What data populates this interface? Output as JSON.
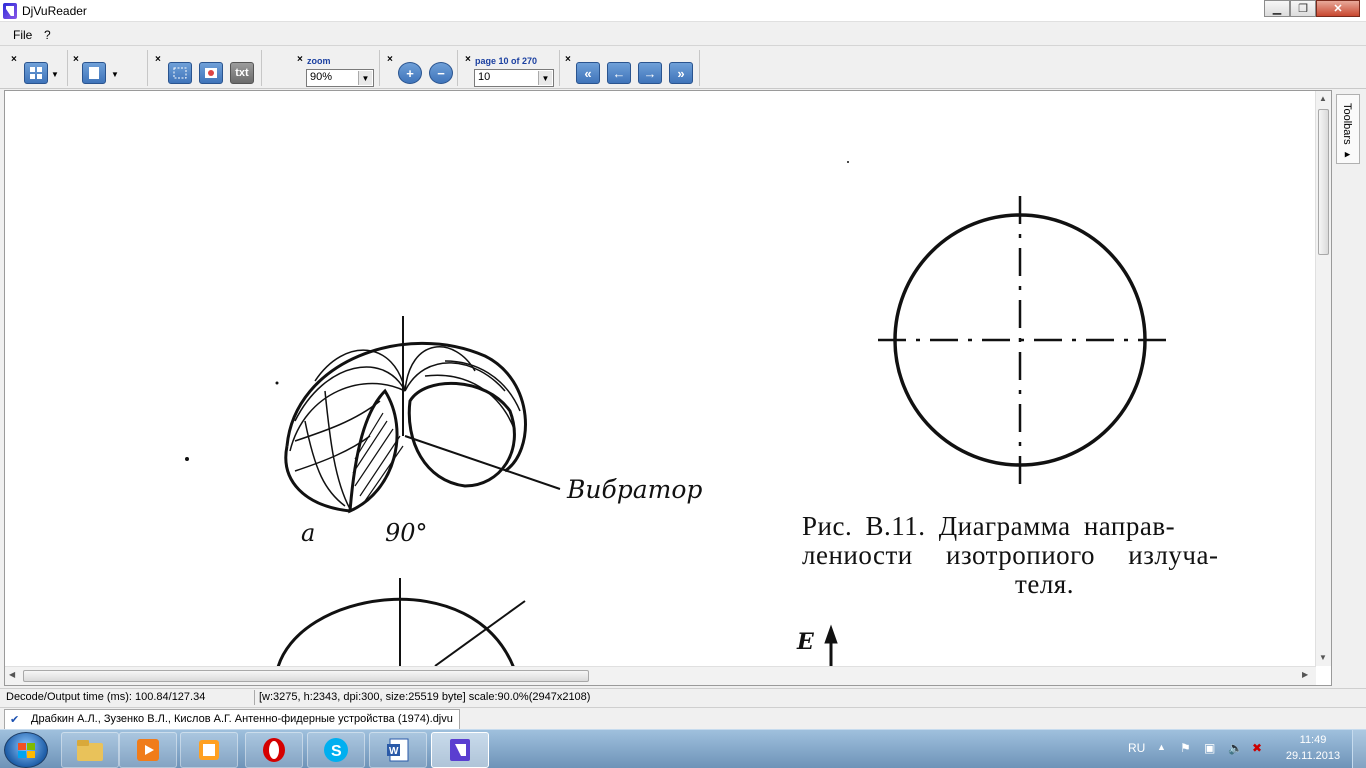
{
  "window": {
    "title": "DjVuReader",
    "minimize": "▁",
    "maximize": "❐",
    "close": "✕"
  },
  "menu": {
    "file": "File",
    "help": "?"
  },
  "toolbar": {
    "close_glyph": "×",
    "text_button": "txt",
    "zoom_label": "zoom",
    "zoom_value": "90%",
    "zoom_in": "+",
    "zoom_out": "−",
    "page_label": "page 10 of 270",
    "page_value": "10",
    "first_page": "«",
    "prev_page": "←",
    "next_page": "→",
    "last_page": "»"
  },
  "side_panel": {
    "toolbars_label": "Toolbars ▸"
  },
  "document": {
    "figure_a_label": "a",
    "angle_label": "90°",
    "vibrator_label": "Вибратор",
    "caption_line1": "Рис. В.11. Диаграмма направ-",
    "caption_line2": "лениости изотропиого излуча-",
    "caption_line3": "теля.",
    "e_label": "E"
  },
  "status": {
    "decode_time": "Decode/Output time (ms): 100.84/127.34",
    "page_info": "[w:3275, h:2343, dpi:300, size:25519 byte] scale:90.0%(2947x2108)"
  },
  "doc_tab": {
    "label": "Драбкин А.Л., Зузенко В.Л., Кислов А.Г. Антенно-фидерные устройства (1974).djvu"
  },
  "tray": {
    "language": "RU",
    "time": "11:49",
    "date": "29.11.2013"
  }
}
